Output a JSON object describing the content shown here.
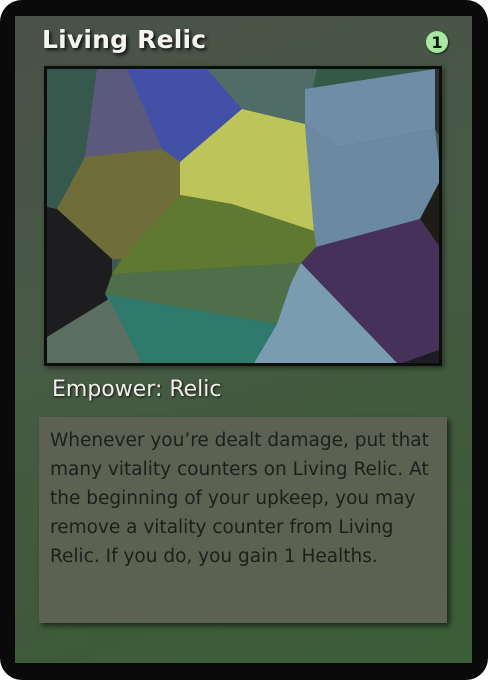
{
  "card": {
    "title": "Living Relic",
    "mana_cost": "1",
    "type_line": "Empower: Relic",
    "rules_text": "Whenever you’re dealt damage, put that many vitality counters on Living Relic. At the beginning of your upkeep, you may remove a vitality counter from Living Relic. If you do, you gain 1 Healths.",
    "colors": {
      "frame": "#0a0a0a",
      "face": "#485a46",
      "mana_symbol": "#a8e7a2",
      "text_box": "#5c6151"
    }
  }
}
